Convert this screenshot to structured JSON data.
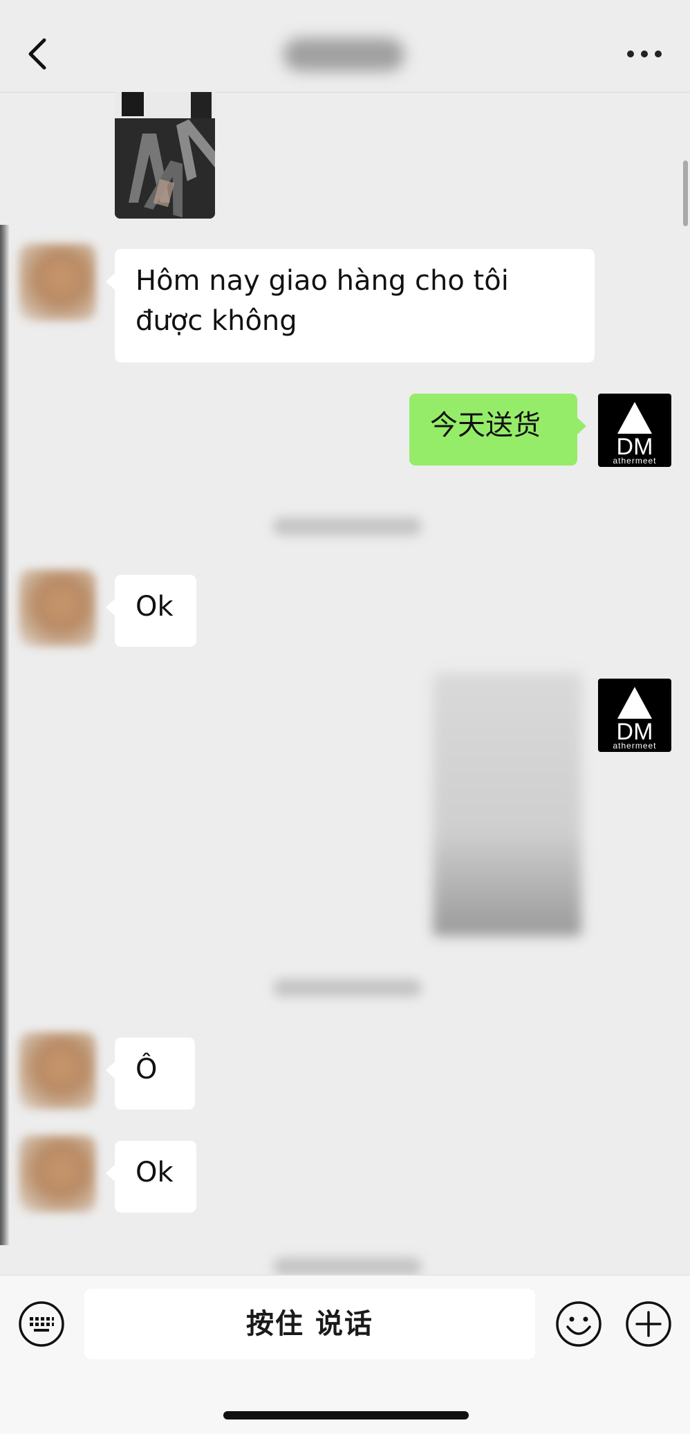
{
  "header": {
    "back_icon": "chevron-left-icon",
    "more_icon": "ellipsis-icon"
  },
  "messages": [
    {
      "from": "contact",
      "type": "text",
      "text": "Hôm nay giao hàng cho tôi được không"
    },
    {
      "from": "me",
      "type": "text",
      "text": "今天送货"
    },
    {
      "from": "contact",
      "type": "text",
      "text": "Ok"
    },
    {
      "from": "me",
      "type": "image"
    },
    {
      "from": "contact",
      "type": "text",
      "text": "Ô"
    },
    {
      "from": "contact",
      "type": "text",
      "text": "Ok"
    }
  ],
  "my_avatar": {
    "logo_text": "DM",
    "logo_subtext": "athermeet"
  },
  "bottom_bar": {
    "hold_to_talk_label": "按住 说话",
    "keyboard_icon": "keyboard-icon",
    "emoji_icon": "smiley-icon",
    "plus_icon": "plus-circle-icon"
  },
  "colors": {
    "background": "#ededed",
    "my_bubble": "#95ec69",
    "their_bubble": "#ffffff"
  }
}
